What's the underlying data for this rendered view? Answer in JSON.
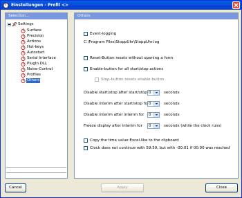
{
  "window": {
    "title": "Einstellungen - Profil <>"
  },
  "left_panel": {
    "header": "Selection..."
  },
  "tree": {
    "root": "Settings",
    "items": [
      {
        "label": "Surface"
      },
      {
        "label": "Precision"
      },
      {
        "label": "Actions"
      },
      {
        "label": "Hot-keys"
      },
      {
        "label": "Autostart"
      },
      {
        "label": "Serial Interface"
      },
      {
        "label": "PlugIn DLL"
      },
      {
        "label": "Noise-Control"
      },
      {
        "label": "Profiles"
      },
      {
        "label": "Others",
        "selected": true
      }
    ]
  },
  "right_panel": {
    "header": "Others",
    "event_logging": {
      "label": "Event-logging",
      "checked": false
    },
    "log_path": "C:\\Program Files\\StoppUhr\\StoppUhr.log",
    "reset_button": {
      "label": "Reset-Button resets without opening a form",
      "checked": false
    },
    "enable_button": {
      "label": "Enable-button for all start/stop actions",
      "checked": false
    },
    "stop_button": {
      "label": "Stop-button resets enable button",
      "checked": false,
      "disabled": true
    },
    "spinners": [
      {
        "label": "Disable start/stop after start/stop for",
        "value": "0",
        "unit": "seconds"
      },
      {
        "label": "Disable interim after start/stop for",
        "value": "0",
        "unit": "seconds"
      },
      {
        "label": "Disable interim after interim for",
        "value": "0",
        "unit": "seconds"
      },
      {
        "label": "Freeze display after interim for",
        "value": "0",
        "unit": "seconds (while the clock runs)"
      }
    ],
    "copy_time": {
      "label": "Copy the time value Excel-like to the clipboard",
      "checked": false
    },
    "clock_continue": {
      "label": "Clock does not continue with 59:59, but with -00:01 if 00:00 was reached",
      "checked": false
    }
  },
  "buttons": {
    "cancel": "Cancel",
    "apply": "Apply",
    "close": "Close"
  },
  "colors": {
    "titlebar": "#0a5ee4",
    "panel_header": "#7a96df",
    "selection": "#316ac5",
    "background": "#ece9d8"
  },
  "icons": {
    "tree_item": "stopwatch-icon",
    "root": "tools-icon",
    "window": "app-icon",
    "close": "close-icon"
  }
}
